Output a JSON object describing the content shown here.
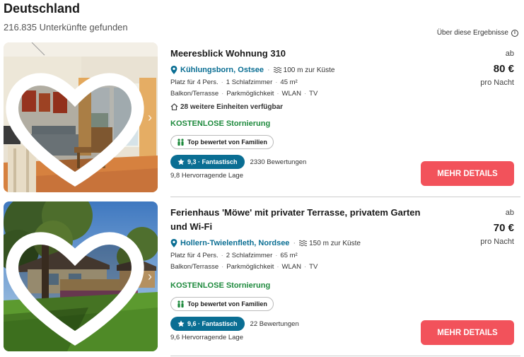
{
  "header": {
    "title": "Deutschland",
    "result_count": "216.835 Unterkünfte gefunden",
    "about_results": "Über diese Ergebnisse"
  },
  "listings": [
    {
      "title": "Meeresblick Wohnung 310",
      "location": "Kühlungsborn, Ostsee",
      "distance": "100 m zur Küste",
      "features_row1": [
        "Platz für 4 Pers.",
        "1 Schlafzimmer",
        "45 m²"
      ],
      "features_row2": [
        "Balkon/Terrasse",
        "Parkmöglichkeit",
        "WLAN",
        "TV"
      ],
      "more_units": "28 weitere Einheiten verfügbar",
      "cancellation": "KOSTENLOSE Stornierung",
      "family_badge": "Top bewertet von Familien",
      "rating": "9,3 · Fantastisch",
      "reviews": "2330 Bewertungen",
      "location_score": "9,8 Hervorragende Lage",
      "price_prefix": "ab",
      "price": "80 €",
      "price_unit": "pro Nacht",
      "button": "MEHR DETAILS"
    },
    {
      "title": "Ferienhaus 'Möwe' mit privater Terrasse, privatem Garten und Wi-Fi",
      "location": "Hollern-Twielenfleth, Nordsee",
      "distance": "150 m zur Küste",
      "features_row1": [
        "Platz für 4 Pers.",
        "2 Schlafzimmer",
        "65 m²"
      ],
      "features_row2": [
        "Balkon/Terrasse",
        "Parkmöglichkeit",
        "WLAN",
        "TV"
      ],
      "cancellation": "KOSTENLOSE Stornierung",
      "family_badge": "Top bewertet von Familien",
      "rating": "9,6 · Fantastisch",
      "reviews": "22 Bewertungen",
      "location_score": "9,6 Hervorragende Lage",
      "price_prefix": "ab",
      "price": "70 €",
      "price_unit": "pro Nacht",
      "button": "MEHR DETAILS"
    }
  ],
  "colors": {
    "accent": "#0a6e93",
    "cta": "#f2525b",
    "free_cancel": "#1e8a3d"
  },
  "icons": [
    "info-icon",
    "heart-icon",
    "chevron-right-icon",
    "location-pin-icon",
    "waves-icon",
    "house-icon",
    "family-icon",
    "star-icon"
  ]
}
